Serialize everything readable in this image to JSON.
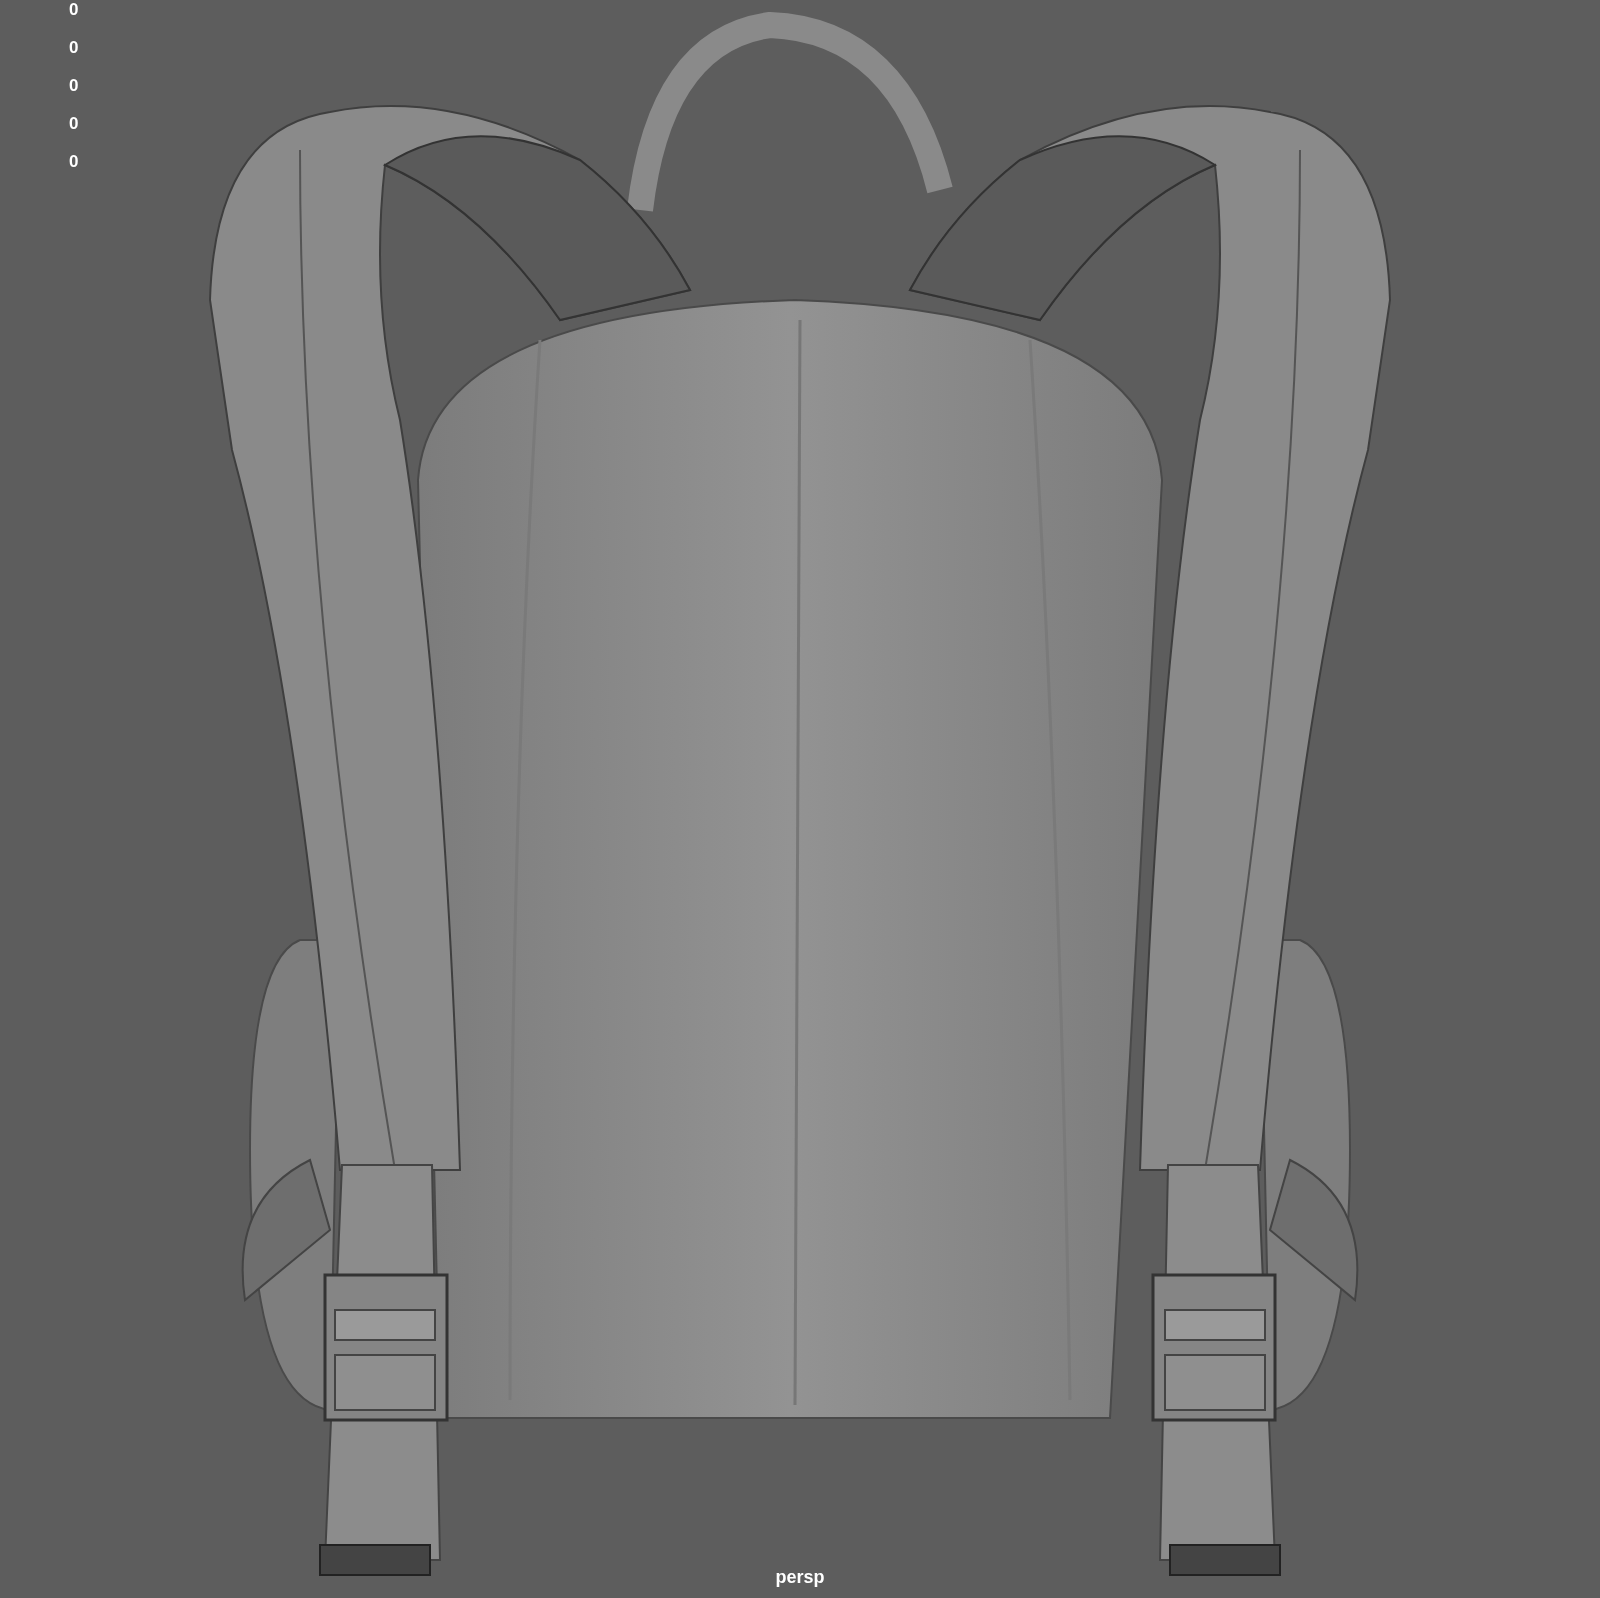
{
  "viewport": {
    "hud_values": [
      "0",
      "0",
      "0",
      "0",
      "0"
    ],
    "camera_label": "persp"
  }
}
